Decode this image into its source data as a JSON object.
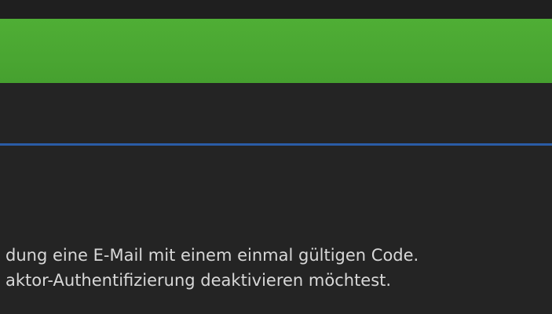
{
  "colors": {
    "background": "#222222",
    "green_bar": "#4aa632",
    "blue_rule": "#2a5ca6",
    "text": "#d8d8d8"
  },
  "content": {
    "lines": [
      "dung eine E-Mail mit einem einmal gültigen Code.",
      "aktor-Authentifizierung deaktivieren möchtest."
    ]
  }
}
